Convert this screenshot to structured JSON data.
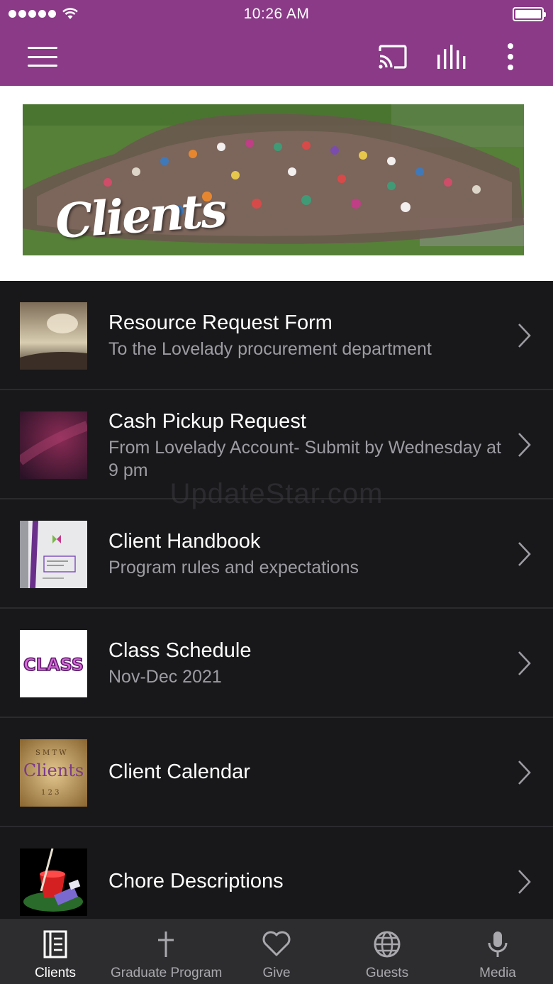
{
  "status_bar": {
    "time": "10:26 AM"
  },
  "app_bar": {
    "menu_icon": "hamburger-menu-icon",
    "cast_icon": "cast-icon",
    "stats_icon": "bar-chart-icon",
    "more_icon": "more-vertical-icon",
    "background_color": "#8a3a87"
  },
  "banner": {
    "title": "Clients"
  },
  "list": {
    "items": [
      {
        "title": "Resource Request Form",
        "subtitle": "To the Lovelady procurement department",
        "thumb": "cloudy-sky-thumbnail"
      },
      {
        "title": "Cash Pickup Request",
        "subtitle": "From Lovelady Account- Submit by Wednesday at 9 pm",
        "thumb": "purple-galaxy-thumbnail"
      },
      {
        "title": "Client Handbook",
        "subtitle": "Program rules and expectations",
        "thumb": "handbook-cover-thumbnail"
      },
      {
        "title": "Class Schedule",
        "subtitle": "Nov-Dec 2021",
        "thumb": "class-text-thumbnail",
        "thumb_text": "CLASS"
      },
      {
        "title": "Client Calendar",
        "subtitle": "",
        "thumb": "clients-calendar-thumbnail",
        "thumb_text": "Clients"
      },
      {
        "title": "Chore Descriptions",
        "subtitle": "",
        "thumb": "bucket-mop-thumbnail"
      }
    ]
  },
  "watermark": "UpdateStar.com",
  "tabs": [
    {
      "label": "Clients",
      "icon": "document-icon",
      "active": true
    },
    {
      "label": "Graduate Program",
      "icon": "cross-icon",
      "active": false
    },
    {
      "label": "Give",
      "icon": "heart-icon",
      "active": false
    },
    {
      "label": "Guests",
      "icon": "globe-icon",
      "active": false
    },
    {
      "label": "Media",
      "icon": "microphone-icon",
      "active": false
    }
  ]
}
